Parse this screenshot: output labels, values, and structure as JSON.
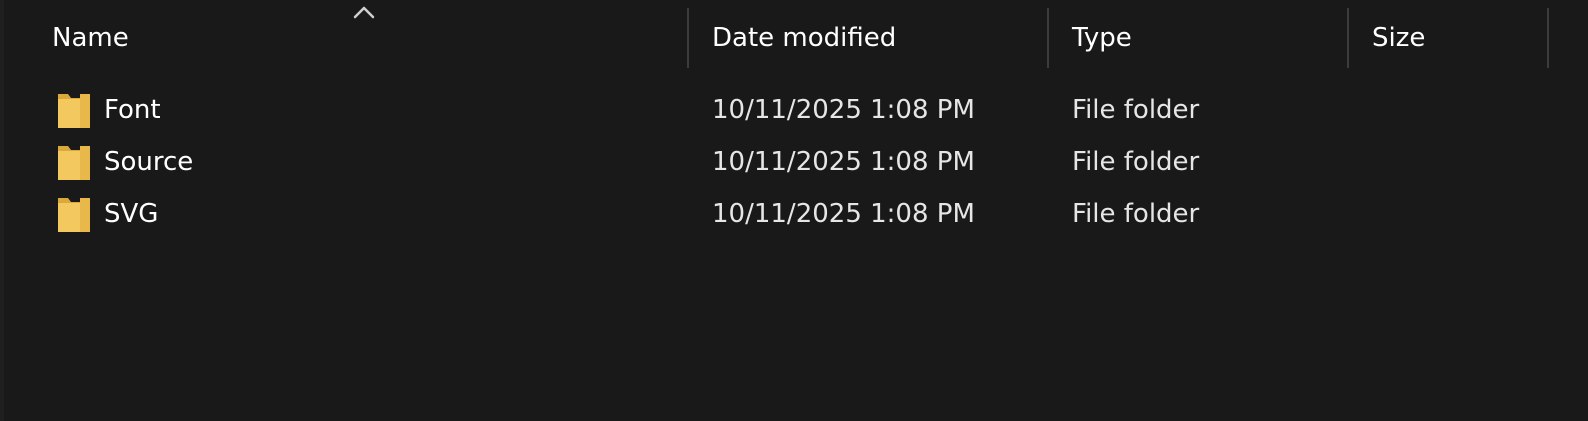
{
  "columns": {
    "name": "Name",
    "date": "Date modified",
    "type": "Type",
    "size": "Size"
  },
  "sort": {
    "column": "Name",
    "direction": "ascending",
    "icon": "chevron-up-icon"
  },
  "colors": {
    "background": "#191919",
    "folder": "#f3c85e",
    "divider": "#3c3c3c"
  },
  "files": [
    {
      "name": "Font",
      "date": "10/11/2025 1:08 PM",
      "type": "File folder",
      "size": "",
      "icon": "folder-icon"
    },
    {
      "name": "Source",
      "date": "10/11/2025 1:08 PM",
      "type": "File folder",
      "size": "",
      "icon": "folder-icon"
    },
    {
      "name": "SVG",
      "date": "10/11/2025 1:08 PM",
      "type": "File folder",
      "size": "",
      "icon": "folder-icon"
    }
  ]
}
